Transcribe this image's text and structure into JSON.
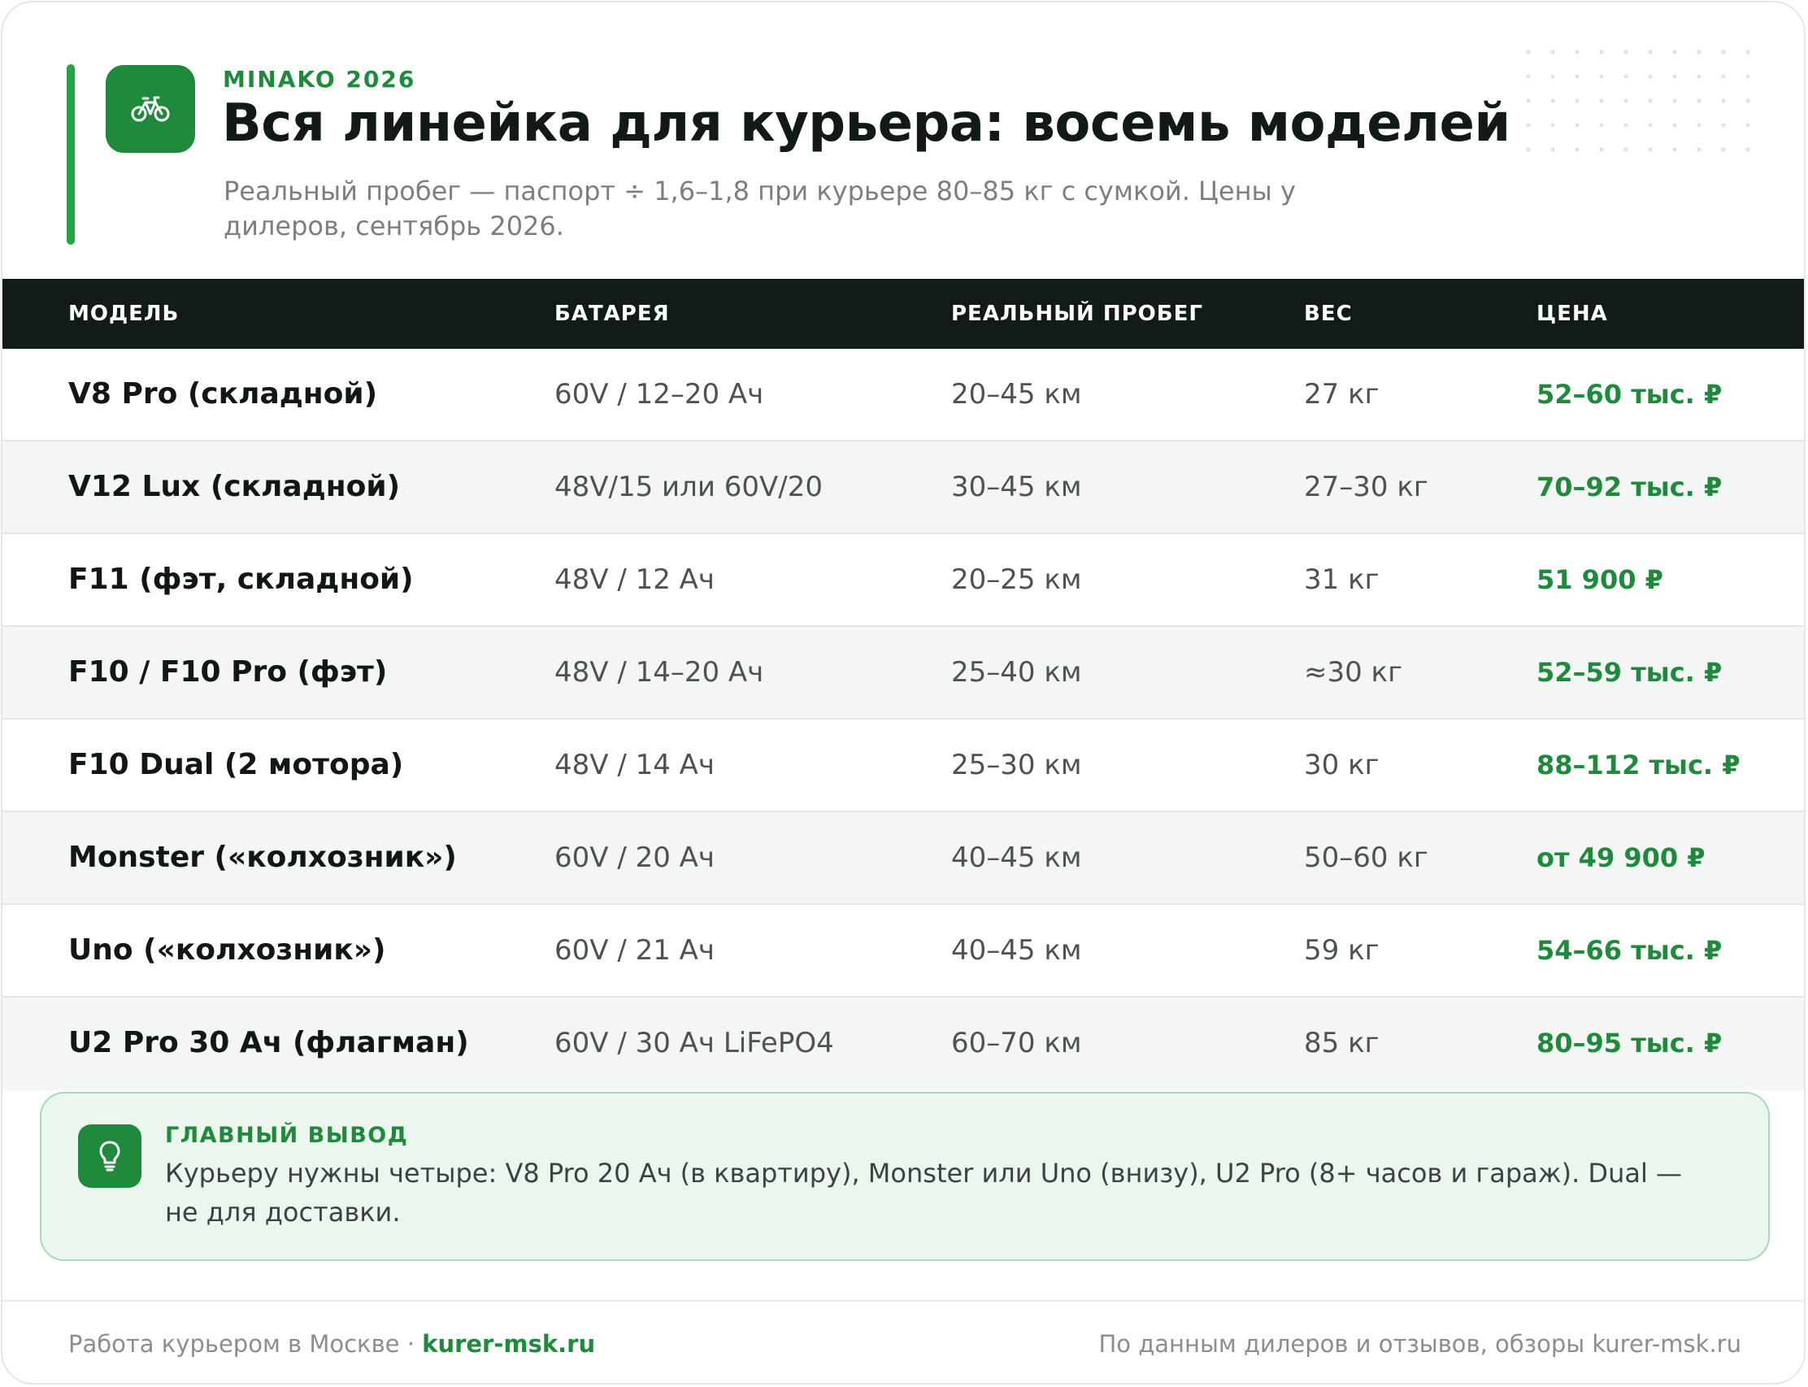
{
  "header": {
    "eyebrow": "MINAKO 2026",
    "title": "Вся линейка для курьера: восемь моделей",
    "subtitle": "Реальный пробег — паспорт ÷ 1,6–1,8 при курьере 80–85 кг с сумкой. Цены у дилеров, сентябрь 2026.",
    "logo_icon": "bicycle-icon"
  },
  "table": {
    "columns": [
      "МОДЕЛЬ",
      "БАТАРЕЯ",
      "РЕАЛЬНЫЙ ПРОБЕГ",
      "ВЕС",
      "ЦЕНА"
    ],
    "rows": [
      [
        "V8 Pro (складной)",
        "60V / 12–20 Ач",
        "20–45 км",
        "27 кг",
        "52–60 тыс. ₽"
      ],
      [
        "V12 Lux (складной)",
        "48V/15 или 60V/20",
        "30–45 км",
        "27–30 кг",
        "70–92 тыс. ₽"
      ],
      [
        "F11 (фэт, складной)",
        "48V / 12 Ач",
        "20–25 км",
        "31 кг",
        "51 900 ₽"
      ],
      [
        "F10 / F10 Pro (фэт)",
        "48V / 14–20 Ач",
        "25–40 км",
        "≈30 кг",
        "52–59 тыс. ₽"
      ],
      [
        "F10 Dual (2 мотора)",
        "48V / 14 Ач",
        "25–30 км",
        "30 кг",
        "88–112 тыс. ₽"
      ],
      [
        "Monster («колхозник»)",
        "60V / 20 Ач",
        "40–45 км",
        "50–60 кг",
        "от 49 900 ₽"
      ],
      [
        "Uno («колхозник»)",
        "60V / 21 Ач",
        "40–45 км",
        "59 кг",
        "54–66 тыс. ₽"
      ],
      [
        "U2 Pro 30 Ач (флагман)",
        "60V / 30 Ач LiFePO4",
        "60–70 км",
        "85 кг",
        "80–95 тыс. ₽"
      ]
    ]
  },
  "callout": {
    "label": "ГЛАВНЫЙ ВЫВОД",
    "text": "Курьеру нужны четыре: V8 Pro 20 Ач (в квартиру), Monster или Uno (внизу), U2 Pro (8+ часов и гараж). Dual — не для доставки.",
    "icon": "lightbulb-icon"
  },
  "footer": {
    "left_text": "Работа курьером в Москве ·",
    "left_site": "kurer-msk.ru",
    "right_text": "По данным дилеров и отзывов, обзоры kurer-msk.ru"
  },
  "colors": {
    "accent": "#1f8a3c",
    "accent_bar": "#22a447",
    "header_bg": "#111c18",
    "row_alt": "#f3f6f4",
    "callout_bg": "#ebf6ee"
  }
}
